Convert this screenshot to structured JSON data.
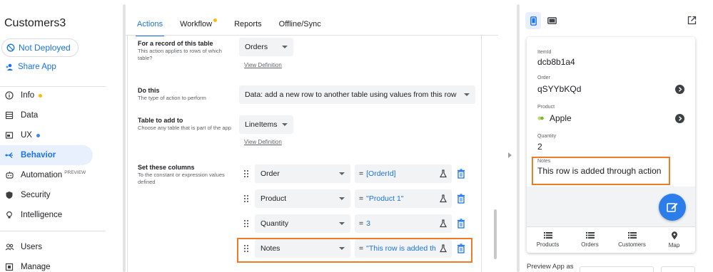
{
  "app": {
    "title": "Customers3"
  },
  "sidebar": {
    "deploy_status": "Not Deployed",
    "share_label": "Share App",
    "items": [
      {
        "label": "Info",
        "icon": "info-icon",
        "dot_color": "#fbbc04"
      },
      {
        "label": "Data",
        "icon": "table-icon"
      },
      {
        "label": "UX",
        "icon": "ux-icon",
        "dot_color": "#4285f4"
      },
      {
        "label": "Behavior",
        "icon": "behavior-icon",
        "active": true
      },
      {
        "label": "Automation",
        "icon": "automation-icon",
        "badge": "PREVIEW"
      },
      {
        "label": "Security",
        "icon": "shield-icon"
      },
      {
        "label": "Intelligence",
        "icon": "bulb-icon"
      }
    ],
    "bottom_items": [
      {
        "label": "Users",
        "icon": "users-icon"
      },
      {
        "label": "Manage",
        "icon": "manage-icon"
      }
    ]
  },
  "tabs": [
    {
      "label": "Actions",
      "active": true
    },
    {
      "label": "Workflow",
      "dot_color": "#fbbc04"
    },
    {
      "label": "Reports"
    },
    {
      "label": "Offline/Sync"
    }
  ],
  "form": {
    "record": {
      "label": "For a record of this table",
      "desc": "This action applies to rows of which table?",
      "value": "Orders",
      "link": "View Definition"
    },
    "do_this": {
      "label": "Do this",
      "desc": "The type of action to perform",
      "value": "Data: add a new row to another table using values from this row"
    },
    "table_add": {
      "label": "Table to add to",
      "desc": "Choose any table that is part of the app",
      "value": "LineItems",
      "link": "View Definition"
    },
    "set_columns": {
      "label": "Set these columns",
      "desc": "To the constant or expression values defined"
    },
    "columns": [
      {
        "name": "Order",
        "value": "[OrderId]"
      },
      {
        "name": "Product",
        "value": "\"Product 1\""
      },
      {
        "name": "Quantity",
        "value": "3"
      },
      {
        "name": "Notes",
        "value": "\"This row is added th"
      }
    ],
    "eq_sign": "="
  },
  "preview": {
    "fields": [
      {
        "label": "ItemId",
        "value": "dcb8b1a4"
      },
      {
        "label": "Order",
        "value": "qSYYbKQd"
      },
      {
        "label": "Product",
        "value": "Apple"
      },
      {
        "label": "Quantity",
        "value": "2"
      },
      {
        "label": "Notes",
        "value": "This row is added through action"
      }
    ],
    "nav": [
      {
        "label": "Products",
        "icon": "list-icon"
      },
      {
        "label": "Orders",
        "icon": "list-icon"
      },
      {
        "label": "Customers",
        "icon": "list-icon"
      },
      {
        "label": "Map",
        "icon": "map-pin-icon"
      }
    ],
    "preview_as_label": "Preview App as"
  },
  "colors": {
    "accent": "#1a73e8",
    "highlight": "#f07c2a",
    "fab": "#2b7de9"
  }
}
